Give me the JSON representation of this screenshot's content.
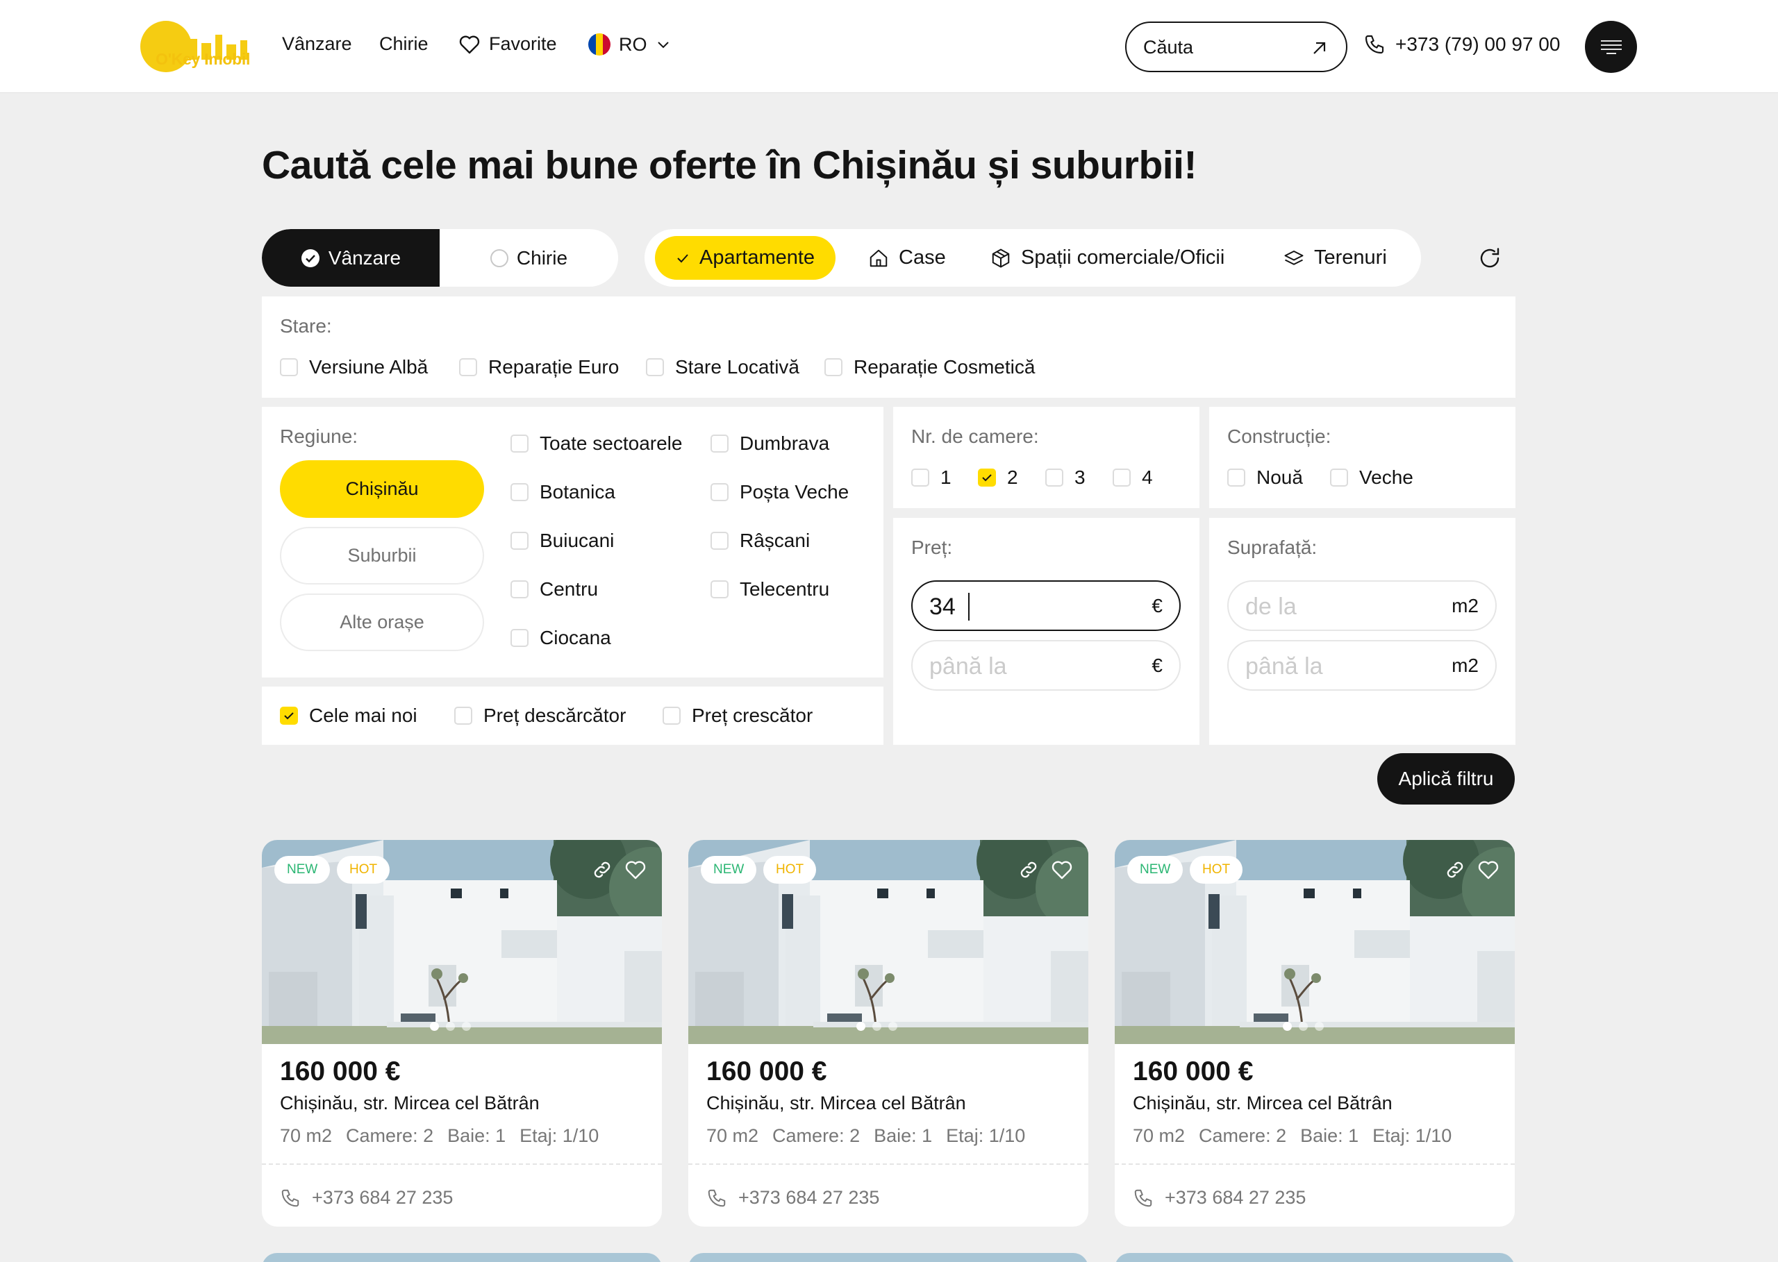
{
  "header": {
    "logo_text": "O'Key Imobil",
    "nav": [
      "Vânzare",
      "Chirie",
      "Favorite"
    ],
    "language": "RO",
    "search_placeholder": "Căuta",
    "phone": "+373 (79) 00 97 00"
  },
  "page_title": "Caută cele mai bune oferte în Chișinău și suburbii!",
  "deal_type": {
    "options": [
      "Vânzare",
      "Chirie"
    ],
    "selected": "Vânzare"
  },
  "property_types": {
    "options": [
      "Apartamente",
      "Case",
      "Spații comerciale/Oficii",
      "Terenuri"
    ],
    "selected": "Apartamente"
  },
  "condition": {
    "label": "Stare:",
    "options": [
      "Versiune Albă",
      "Reparație Euro",
      "Stare Locativă",
      "Reparație Cosmetică"
    ]
  },
  "region": {
    "label": "Regiune:",
    "pills": [
      "Chișinău",
      "Suburbii",
      "Alte orașe"
    ],
    "selected": "Chișinău",
    "sectors_left": [
      "Toate sectoarele",
      "Botanica",
      "Buiucani",
      "Centru",
      "Ciocana"
    ],
    "sectors_right": [
      "Dumbrava",
      "Poșta Veche",
      "Râșcani",
      "Telecentru"
    ]
  },
  "sort": {
    "options": [
      "Cele mai noi",
      "Preț descărcător",
      "Preț crescător"
    ],
    "selected": "Cele mai noi"
  },
  "rooms": {
    "label": "Nr. de camere:",
    "options": [
      "1",
      "2",
      "3",
      "4"
    ],
    "selected": "2"
  },
  "construction": {
    "label": "Construcție:",
    "options": [
      "Nouă",
      "Veche"
    ]
  },
  "price": {
    "label": "Preț:",
    "from_value": "34",
    "to_placeholder": "până la",
    "unit": "€"
  },
  "area": {
    "label": "Suprafață:",
    "from_placeholder": "de la",
    "to_placeholder": "până la",
    "unit": "m2"
  },
  "apply_label": "Aplică filtru",
  "listings": [
    {
      "badges": [
        "NEW",
        "HOT"
      ],
      "price": "160 000 €",
      "address": "Chișinău, str. Mircea cel Bătrân",
      "specs": [
        "70 m2",
        "Camere: 2",
        "Baie: 1",
        "Etaj: 1/10"
      ],
      "phone": "+373 684 27 235"
    },
    {
      "badges": [
        "NEW",
        "HOT"
      ],
      "price": "160 000 €",
      "address": "Chișinău, str. Mircea cel Bătrân",
      "specs": [
        "70 m2",
        "Camere: 2",
        "Baie: 1",
        "Etaj: 1/10"
      ],
      "phone": "+373 684 27 235"
    },
    {
      "badges": [
        "NEW",
        "HOT"
      ],
      "price": "160 000 €",
      "address": "Chișinău, str. Mircea cel Bătrân",
      "specs": [
        "70 m2",
        "Camere: 2",
        "Baie: 1",
        "Etaj: 1/10"
      ],
      "phone": "+373 684 27 235"
    }
  ],
  "colors": {
    "accent": "#ffdc00",
    "dark": "#141414",
    "badge_new": "#2bb673",
    "badge_hot": "#f0b400"
  }
}
